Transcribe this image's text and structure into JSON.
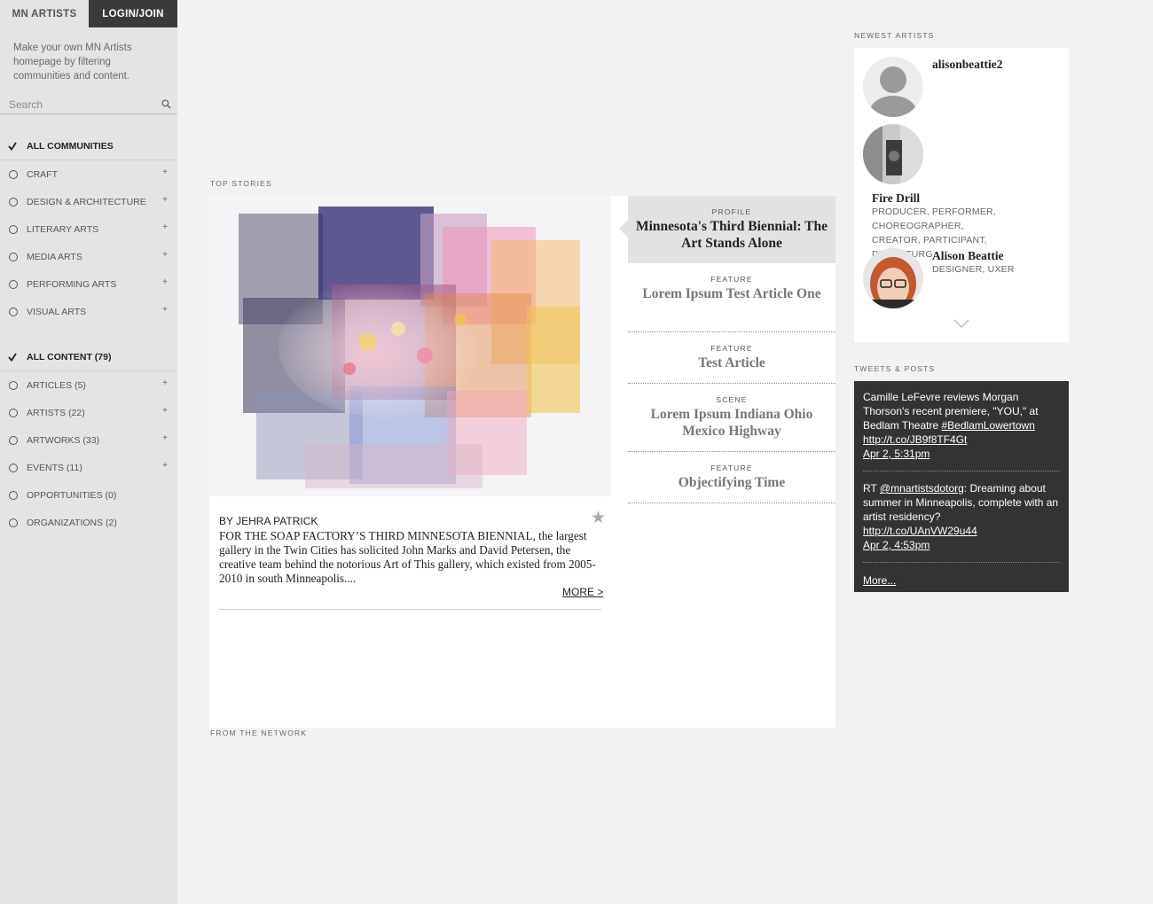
{
  "sidebar": {
    "brand": "MN ARTISTS",
    "login": "LOGIN/JOIN",
    "intro": "Make your own MN Artists homepage by filtering communities and content.",
    "search_placeholder": "Search",
    "communities": {
      "all_label": "ALL COMMUNITIES",
      "items": [
        {
          "label": "CRAFT"
        },
        {
          "label": "DESIGN & ARCHITECTURE"
        },
        {
          "label": "LITERARY ARTS"
        },
        {
          "label": "MEDIA ARTS"
        },
        {
          "label": "PERFORMING ARTS"
        },
        {
          "label": "VISUAL ARTS"
        }
      ]
    },
    "content": {
      "all_label": "ALL CONTENT (79)",
      "items": [
        {
          "label": "ARTICLES (5)",
          "expandable": true
        },
        {
          "label": "ARTISTS (22)",
          "expandable": true
        },
        {
          "label": "ARTWORKS (33)",
          "expandable": true
        },
        {
          "label": "EVENTS (11)",
          "expandable": true
        },
        {
          "label": "OPPORTUNITIES (0)",
          "expandable": false
        },
        {
          "label": "ORGANIZATIONS (2)",
          "expandable": false
        }
      ]
    }
  },
  "main": {
    "top_stories_label": "TOP STORIES",
    "from_network_label": "FROM THE NETWORK",
    "feature": {
      "byline": "BY JEHRA PATRICK",
      "excerpt": "FOR THE SOAP FACTORY’S THIRD MINNESOTA BIENNIAL, the largest gallery in the Twin Cities has solicited John Marks and David Petersen, the creative team behind the notorious Art of This gallery, which existed from 2005-2010 in south Minneapolis....",
      "more": "MORE >",
      "star": "★"
    },
    "stories": [
      {
        "type": "PROFILE",
        "title": "Minnesota's Third Biennial: The Art Stands Alone",
        "active": true
      },
      {
        "type": "FEATURE",
        "title": "Lorem Ipsum Test Article One",
        "active": false
      },
      {
        "type": "FEATURE",
        "title": "Test Article",
        "active": false
      },
      {
        "type": "SCENE",
        "title": "Lorem Ipsum Indiana Ohio Mexico Highway",
        "active": false
      },
      {
        "type": "FEATURE",
        "title": "Objectifying Time",
        "active": false
      }
    ]
  },
  "right": {
    "newest_label": "NEWEST ARTISTS",
    "artists": [
      {
        "name": "alisonbeattie2",
        "roles": ""
      },
      {
        "name": "Fire Drill",
        "roles": "PRODUCER, PERFORMER, CHOREOGRAPHER, CREATOR, PARTICIPANT, DRAMATURG"
      },
      {
        "name": "Alison Beattie",
        "roles": "DESIGNER, UXER"
      }
    ],
    "tweets_label": "TWEETS & POSTS",
    "tweets": {
      "t1_text": "Camille LeFevre reviews Morgan Thorson's recent premiere, \"YOU,\" at Bedlam Theatre ",
      "t1_tag": "#BedlamLowertown",
      "t1_link": "http://t.co/JB9f8TF4Gt",
      "t1_date": "Apr 2, 5:31pm",
      "t2_prefix": "RT ",
      "t2_handle": "@mnartistsdotorg",
      "t2_text": ": Dreaming about summer in Minneapolis, complete with an artist residency?",
      "t2_link": "http://t.co/UAnVW29u44",
      "t2_date": "Apr 2, 4:53pm",
      "more": "More..."
    }
  },
  "colors": {
    "sidebar_bg": "#e4e4e4",
    "login_bg": "#3a3a3a",
    "page_bg": "#f2f2f2",
    "tweets_bg": "#333333",
    "active_story_bg": "#e2e2e2"
  }
}
